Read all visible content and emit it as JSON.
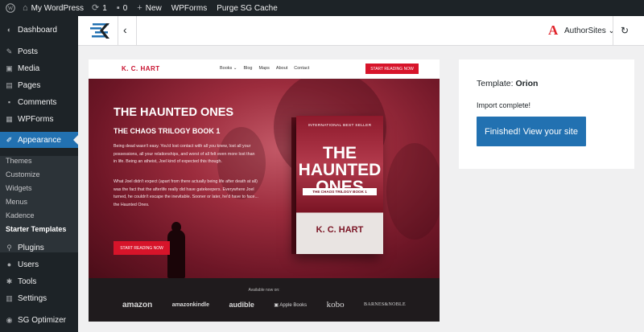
{
  "admin_bar": {
    "site_name": "My WordPress",
    "updates_count": "1",
    "comments_count": "0",
    "new_label": "New",
    "wpforms_label": "WPForms",
    "purge_label": "Purge SG Cache"
  },
  "sidebar": {
    "items": [
      {
        "label": "Dashboard",
        "icon": "dashboard-icon"
      },
      {
        "label": "Posts",
        "icon": "pin-icon"
      },
      {
        "label": "Media",
        "icon": "media-icon"
      },
      {
        "label": "Pages",
        "icon": "pages-icon"
      },
      {
        "label": "Comments",
        "icon": "comments-icon"
      },
      {
        "label": "WPForms",
        "icon": "wpforms-icon"
      },
      {
        "label": "Appearance",
        "icon": "brush-icon"
      },
      {
        "label": "Plugins",
        "icon": "plugin-icon"
      },
      {
        "label": "Users",
        "icon": "users-icon"
      },
      {
        "label": "Tools",
        "icon": "wrench-icon"
      },
      {
        "label": "Settings",
        "icon": "settings-icon"
      },
      {
        "label": "SG Optimizer",
        "icon": "sg-optimizer-icon"
      }
    ],
    "submenu": [
      "Themes",
      "Customize",
      "Widgets",
      "Menus",
      "Kadence",
      "Starter Templates"
    ],
    "active_item": "Appearance",
    "current_submenu": "Starter Templates"
  },
  "header": {
    "authorsites_label": "AuthorSites",
    "brand_color": "#2271b1",
    "authorsites_color": "#e0232a"
  },
  "preview": {
    "site_logo": "K. C. HART",
    "nav_links": [
      "Books",
      "Blog",
      "Maps",
      "About",
      "Contact"
    ],
    "nav_cta": "START READING NOW",
    "hero_title": "THE HAUNTED ONES",
    "hero_subtitle": "THE CHAOS TRILOGY BOOK 1",
    "hero_paragraph_1": "Being dead wasn't easy. You'd lost contact with all you knew, lost all your possessions, all your relationships, and worst of all felt even more lost than in life. Being an atheist, Joel kind of expected this though.",
    "hero_paragraph_2": "What Joel didn't expect (apart from there actually being life after death at all) was the fact that the afterlife really did have gatekeepers. Everywhere Joel turned, he couldn't escape the inevitable. Sooner or later, he'd have to face... the Haunted Ones.",
    "hero_cta": "START READING NOW",
    "book": {
      "tagline": "INTERNATIONAL BEST SELLER",
      "title": "THE HAUNTED ONES",
      "series": "THE CHAOS TRILOGY BOOK 1",
      "author": "K. C. HART"
    },
    "available_label": "Available now on:",
    "stores": [
      "amazon",
      "amazonkindle",
      "audible",
      "Apple Books",
      "kobo",
      "BARNES&NOBLE"
    ]
  },
  "panel": {
    "template_prefix": "Template:",
    "template_name": "Orion",
    "import_message": "Import complete!",
    "finish_button": "Finished! View your site"
  }
}
